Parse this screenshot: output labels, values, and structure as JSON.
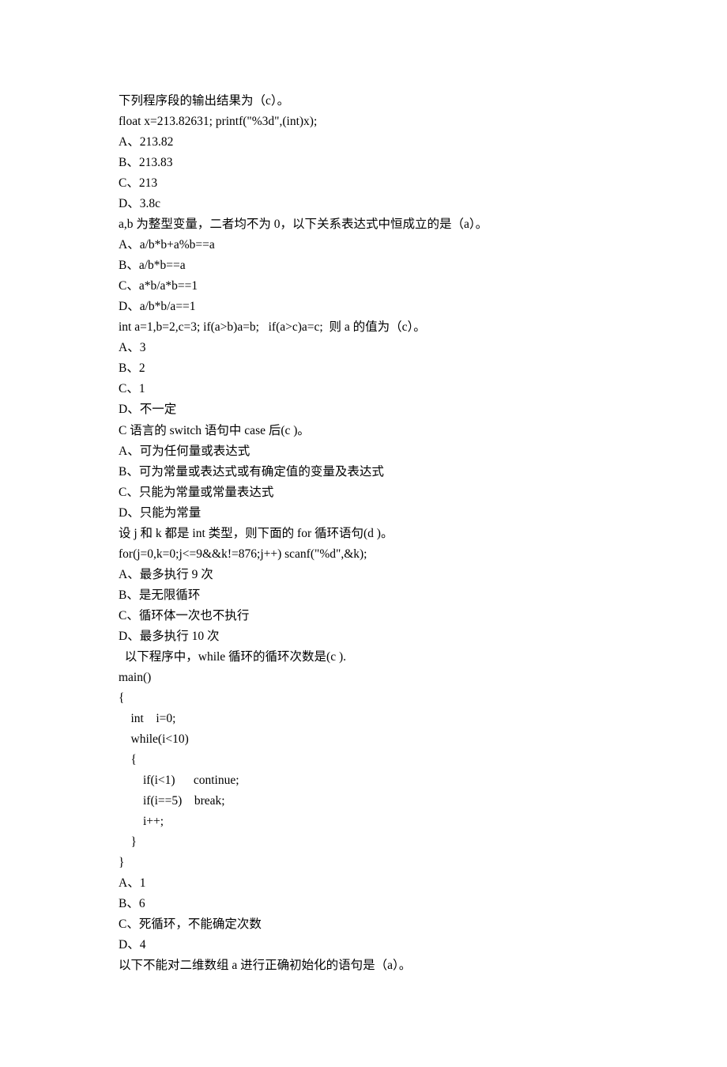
{
  "lines": [
    "下列程序段的输出结果为（c）。",
    "float x=213.82631; printf(\"%3d\",(int)x);",
    "A、213.82",
    "B、213.83",
    "C、213",
    "D、3.8c",
    "a,b 为整型变量，二者均不为 0，以下关系表达式中恒成立的是（a）。",
    "A、a/b*b+a%b==a",
    "B、a/b*b==a",
    "C、a*b/a*b==1",
    "D、a/b*b/a==1",
    "int a=1,b=2,c=3; if(a>b)a=b;   if(a>c)a=c;  则 a 的值为（c）。",
    "A、3",
    "B、2",
    "C、1",
    "D、不一定",
    "C 语言的 switch 语句中 case 后(c )。",
    "A、可为任何量或表达式",
    "B、可为常量或表达式或有确定值的变量及表达式",
    "C、只能为常量或常量表达式",
    "D、只能为常量",
    "设 j 和 k 都是 int 类型，则下面的 for 循环语句(d )。",
    "for(j=0,k=0;j<=9&&k!=876;j++) scanf(\"%d\",&k);",
    "A、最多执行 9 次",
    "B、是无限循环",
    "C、循环体一次也不执行",
    "D、最多执行 10 次",
    "  以下程序中，while 循环的循环次数是(c ).",
    "main()",
    "{",
    "    int    i=0;",
    "    while(i<10)",
    "    {",
    "        if(i<1)      continue;",
    "        if(i==5)    break;",
    "        i++;",
    "    }",
    "}",
    "",
    "A、1",
    "B、6",
    "C、死循环，不能确定次数",
    "D、4",
    "以下不能对二维数组 a 进行正确初始化的语句是（a）。"
  ]
}
